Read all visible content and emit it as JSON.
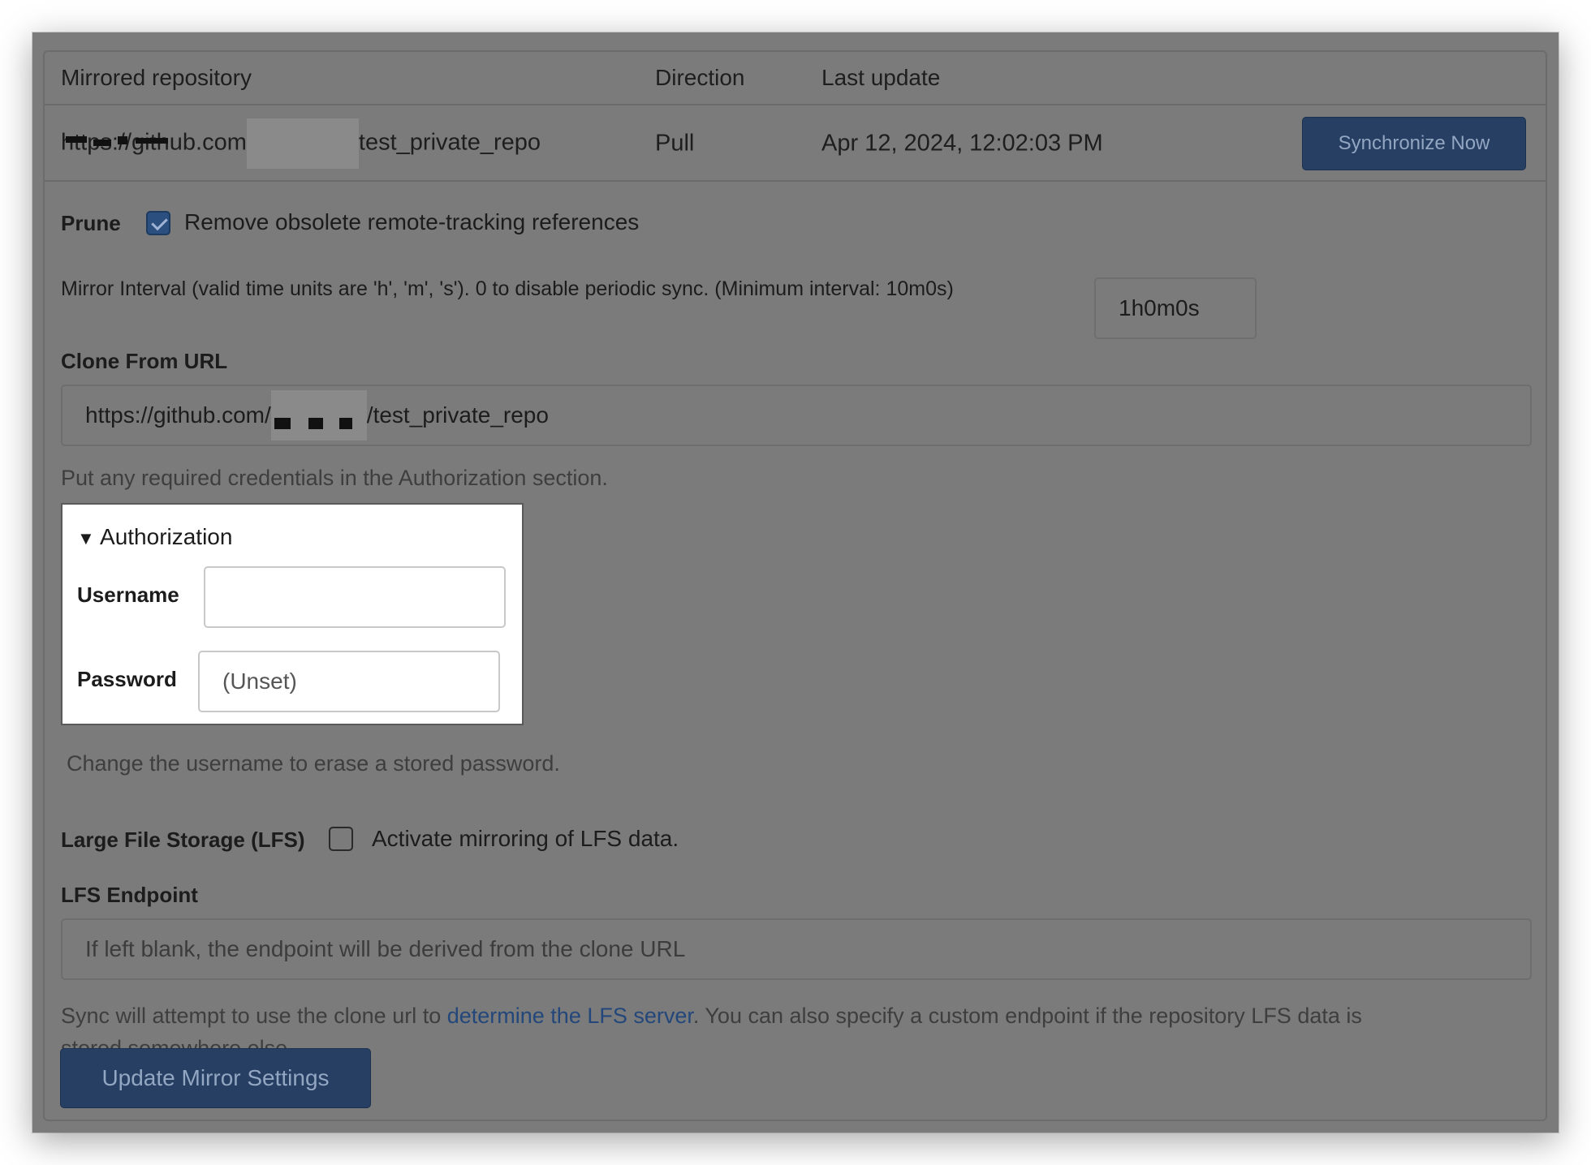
{
  "table": {
    "headers": [
      "Mirrored repository",
      "Direction",
      "Last update"
    ],
    "row": {
      "repo_prefix": "https://github.com",
      "repo_suffix": "test_private_repo",
      "direction": "Pull",
      "last_update": "Apr 12, 2024, 12:02:03 PM"
    },
    "sync_button": "Synchronize Now"
  },
  "prune": {
    "label": "Prune",
    "checked": true,
    "description": "Remove obsolete remote-tracking references"
  },
  "interval": {
    "label": "Mirror Interval (valid time units are 'h', 'm', 's'). 0 to disable periodic sync. (Minimum interval: 10m0s)",
    "value": "1h0m0s"
  },
  "clone": {
    "label": "Clone From URL",
    "url_prefix": "https://github.com/",
    "url_suffix": "/test_private_repo",
    "help": "Put any required credentials in the Authorization section."
  },
  "authorization": {
    "summary": "Authorization",
    "username_label": "Username",
    "username_value": "",
    "password_label": "Password",
    "password_placeholder": "(Unset)",
    "help": "Change the username to erase a stored password."
  },
  "lfs": {
    "label": "Large File Storage (LFS)",
    "checked": false,
    "description": "Activate mirroring of LFS data.",
    "endpoint_label": "LFS Endpoint",
    "endpoint_placeholder": "If left blank, the endpoint will be derived from the clone URL",
    "help_before": "Sync will attempt to use the clone url to ",
    "help_link": "determine the LFS server",
    "help_after": ". You can also specify a custom endpoint if the repository LFS data is",
    "help_line2": "stored somewhere else."
  },
  "update_button": "Update Mirror Settings",
  "colors": {
    "background": "#7b7b7b",
    "primary_button": "#263f63",
    "link": "#23477a"
  }
}
